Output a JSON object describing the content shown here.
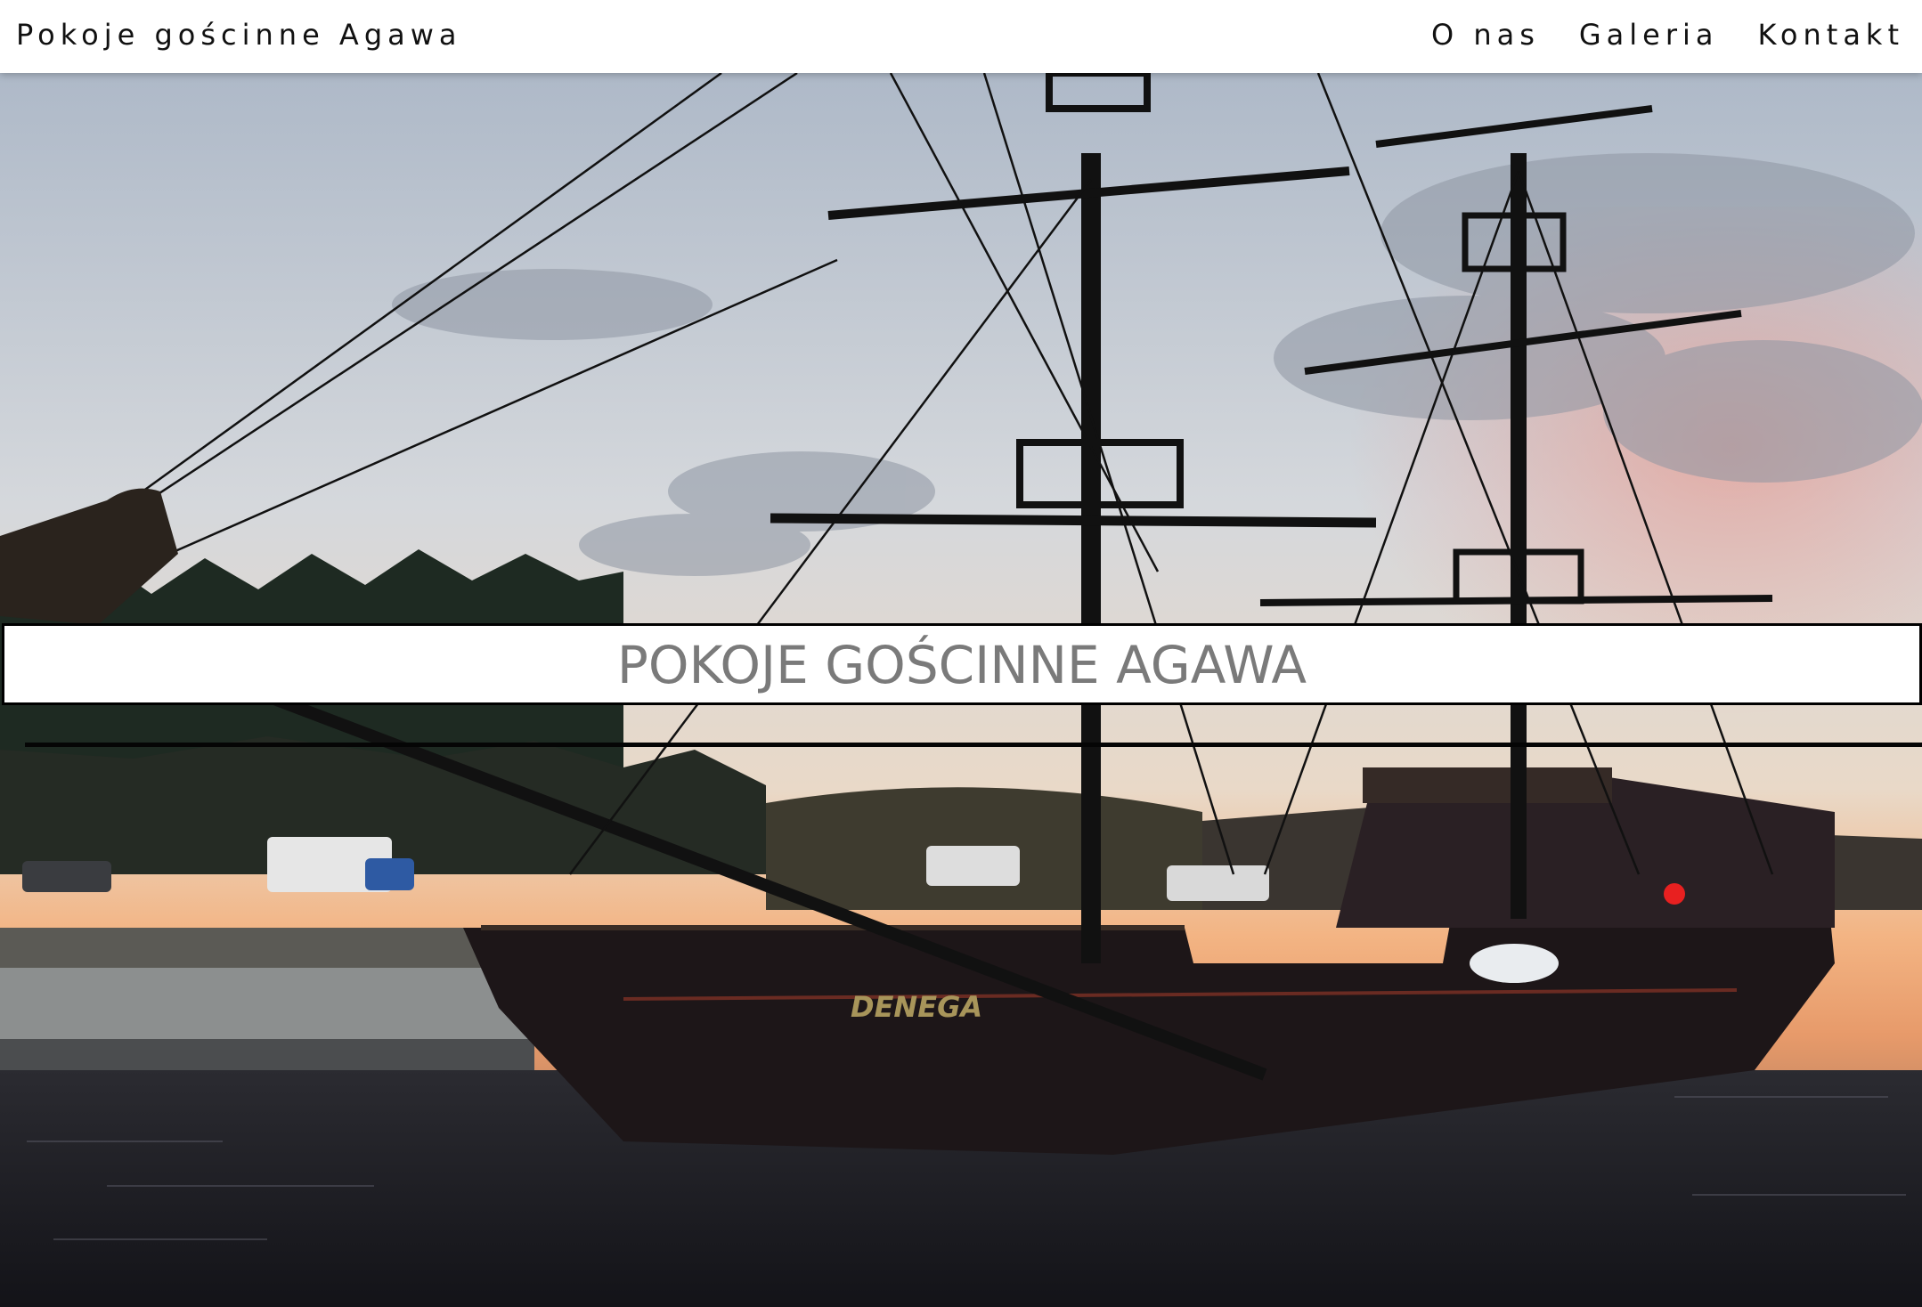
{
  "header": {
    "brand": "Pokoje gościnne Agawa",
    "nav": [
      {
        "label": "O nas"
      },
      {
        "label": "Galeria"
      },
      {
        "label": "Kontakt"
      }
    ]
  },
  "hero": {
    "title": "POKOJE GOŚCINNE AGAWA",
    "ship_name": "DENEGA"
  },
  "colors": {
    "header_bg": "#ffffff",
    "banner_bg": "#ffffff",
    "banner_text": "#7a7a7a",
    "sky_top": "#b9c4d1",
    "sunset": "#f2a36b"
  }
}
